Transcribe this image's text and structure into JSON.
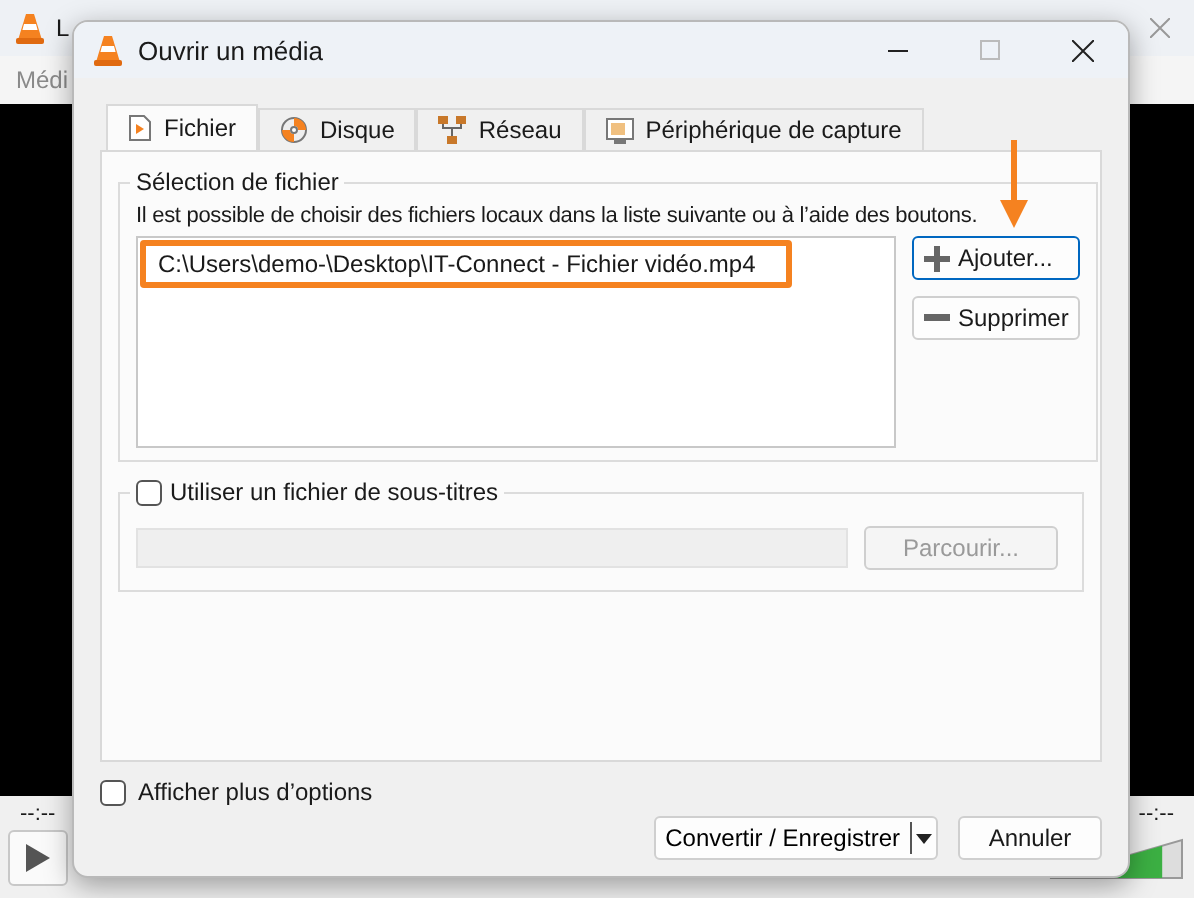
{
  "background_window": {
    "title": "L",
    "menu": [
      "Médi"
    ],
    "time_elapsed": "--:--",
    "time_total": "--:--",
    "volume": {
      "level": 0.85
    }
  },
  "dialog": {
    "title": "Ouvrir un média",
    "tabs": [
      {
        "label": "Fichier",
        "selected": true,
        "kind": "file"
      },
      {
        "label": "Disque",
        "selected": false,
        "kind": "disc"
      },
      {
        "label": "Réseau",
        "selected": false,
        "kind": "network"
      },
      {
        "label": "Périphérique de capture",
        "selected": false,
        "kind": "capture"
      }
    ],
    "file_group": {
      "title": "Sélection de fichier",
      "description": "Il est possible de choisir des fichiers locaux dans la liste suivante ou à l’aide des boutons.",
      "files": [
        {
          "path": "C:\\Users\\demo-\\Desktop\\IT-Connect - Fichier vidéo.mp4",
          "highlighted": true
        }
      ],
      "buttons": [
        {
          "label": "Ajouter...",
          "kind": "add",
          "pointed": true
        },
        {
          "label": "Supprimer",
          "kind": "remove",
          "pointed": false
        }
      ]
    },
    "subtitles": {
      "label": "Utiliser un fichier de sous-titres",
      "checked": false,
      "browse_button": {
        "label": "Parcourir...",
        "disabled": true
      }
    },
    "more_options": {
      "label": "Afficher plus d’options",
      "checked": false
    },
    "buttons": [
      {
        "label": "Convertir / Enregistrer",
        "kind": "split"
      },
      {
        "label": "Annuler",
        "kind": "plain"
      }
    ]
  }
}
